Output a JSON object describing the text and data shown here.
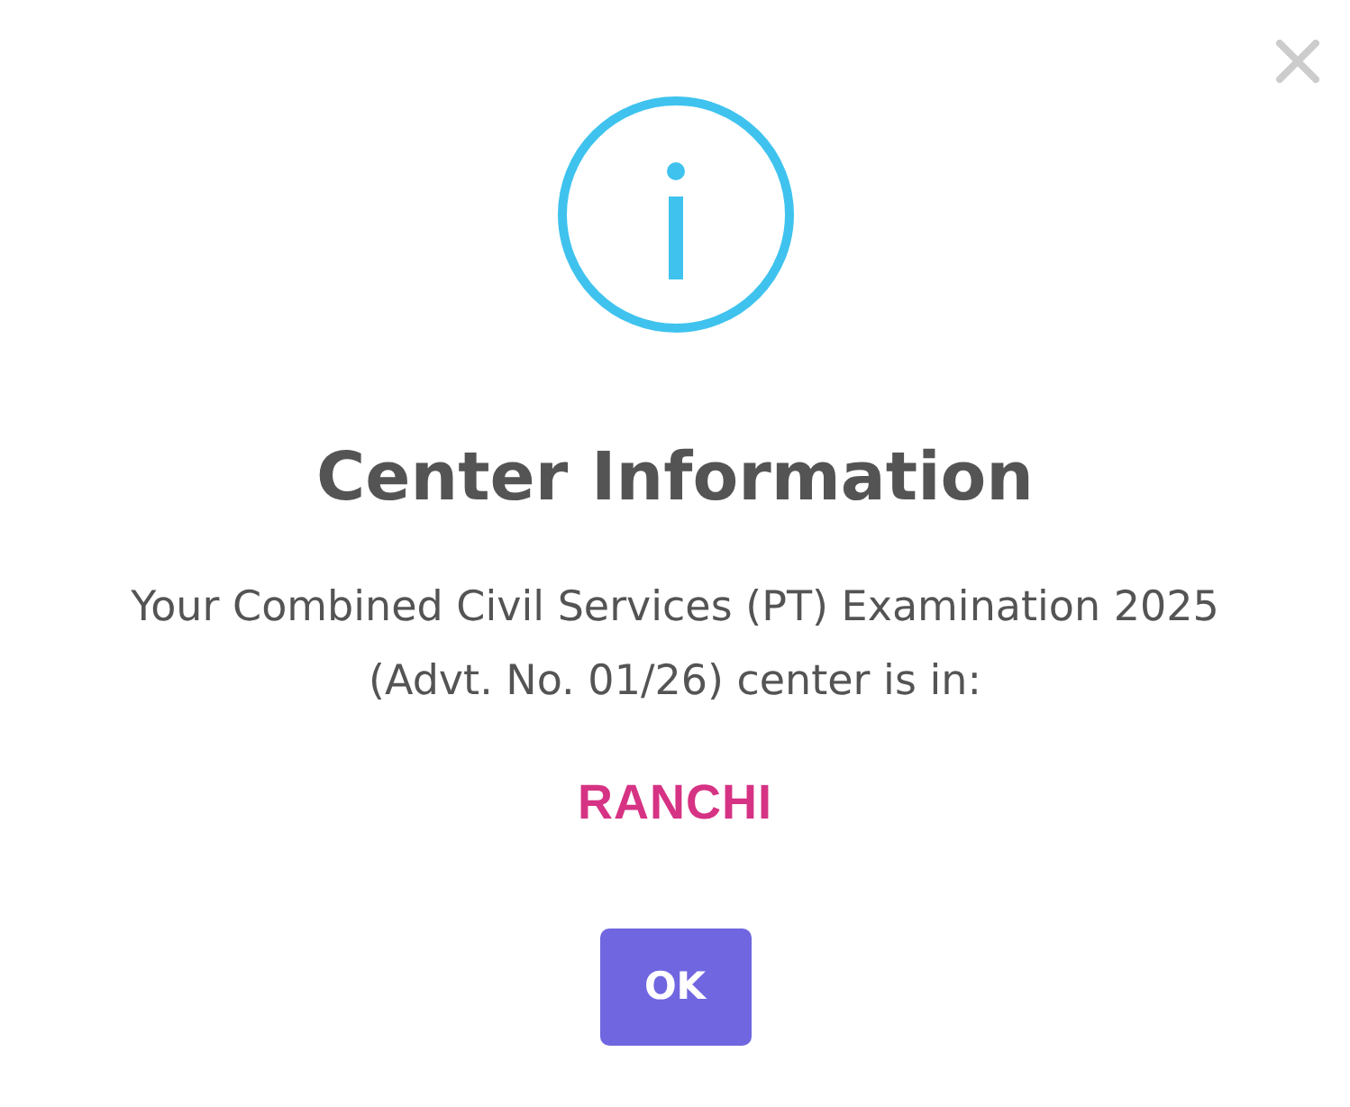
{
  "dialog": {
    "title": "Center Information",
    "message": "Your Combined Civil Services (PT) Examination 2025 (Advt. No. 01/26) center is in:",
    "center_name": "RANCHI",
    "confirm_button": "OK"
  }
}
